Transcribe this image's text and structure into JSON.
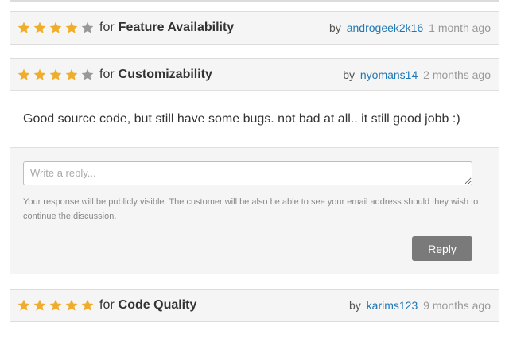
{
  "colors": {
    "star_filled": "#f0ad2c",
    "star_empty": "#999999",
    "author_link": "#1f77b4",
    "reply_button": "#7a7a7a"
  },
  "reviews": [
    {
      "rating": 4,
      "max_rating": 5,
      "for_word": "for",
      "category": "Feature Availability",
      "by_word": "by",
      "author": "androgeek2k16",
      "time": "1 month ago"
    },
    {
      "rating": 4,
      "max_rating": 5,
      "for_word": "for",
      "category": "Customizability",
      "by_word": "by",
      "author": "nyomans14",
      "time": "2 months ago",
      "comment": "Good source code, but still have some bugs. not bad at all.. it still good jobb :)",
      "reply": {
        "placeholder": "Write a reply...",
        "notice": "Your response will be publicly visible. The customer will be also be able to see your email address should they wish to continue the discussion.",
        "button_label": "Reply"
      }
    },
    {
      "rating": 5,
      "max_rating": 5,
      "for_word": "for",
      "category": "Code Quality",
      "by_word": "by",
      "author": "karims123",
      "time": "9 months ago"
    }
  ]
}
